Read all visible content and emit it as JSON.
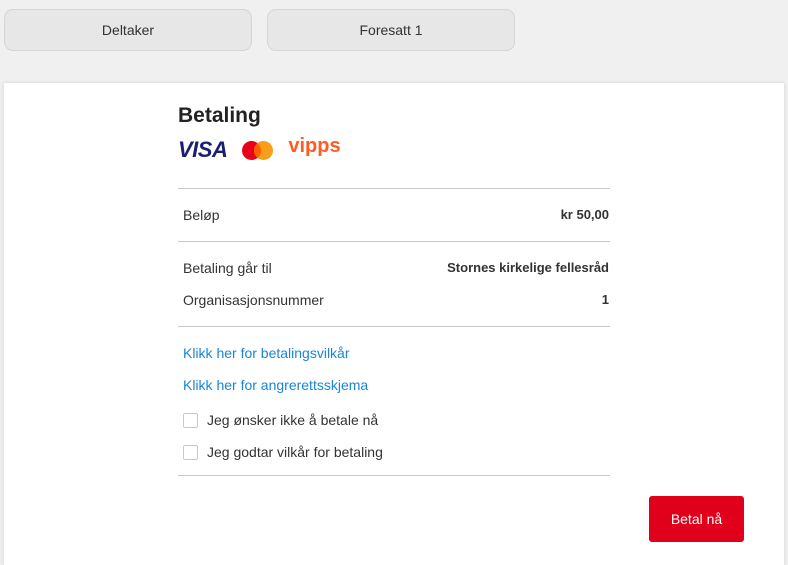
{
  "tabs": [
    {
      "label": "Deltaker"
    },
    {
      "label": "Foresatt 1"
    }
  ],
  "payment": {
    "title": "Betaling",
    "logos": {
      "visa": "VISA",
      "vipps": "vipps"
    },
    "amount": {
      "label": "Beløp",
      "value": "kr 50,00"
    },
    "recipient": {
      "label": "Betaling går til",
      "value": "Stornes kirkelige fellesråd"
    },
    "org_number": {
      "label": "Organisasjonsnummer",
      "value": "1"
    },
    "links": {
      "terms": "Klikk her for betalingsvilkår",
      "withdrawal": "Klikk her for angrerettsskjema"
    },
    "checkboxes": {
      "pay_later": {
        "label": "Jeg ønsker ikke å betale nå",
        "checked": false
      },
      "accept_terms": {
        "label": "Jeg godtar vilkår for betaling",
        "checked": false
      }
    },
    "pay_button": "Betal nå"
  },
  "colors": {
    "pay_button": "#e0001b",
    "link": "#1a85d6",
    "visa": "#1a1f71",
    "vipps": "#ff5b24",
    "mastercard_red": "#eb001b",
    "mastercard_yellow": "#f79e1b"
  }
}
